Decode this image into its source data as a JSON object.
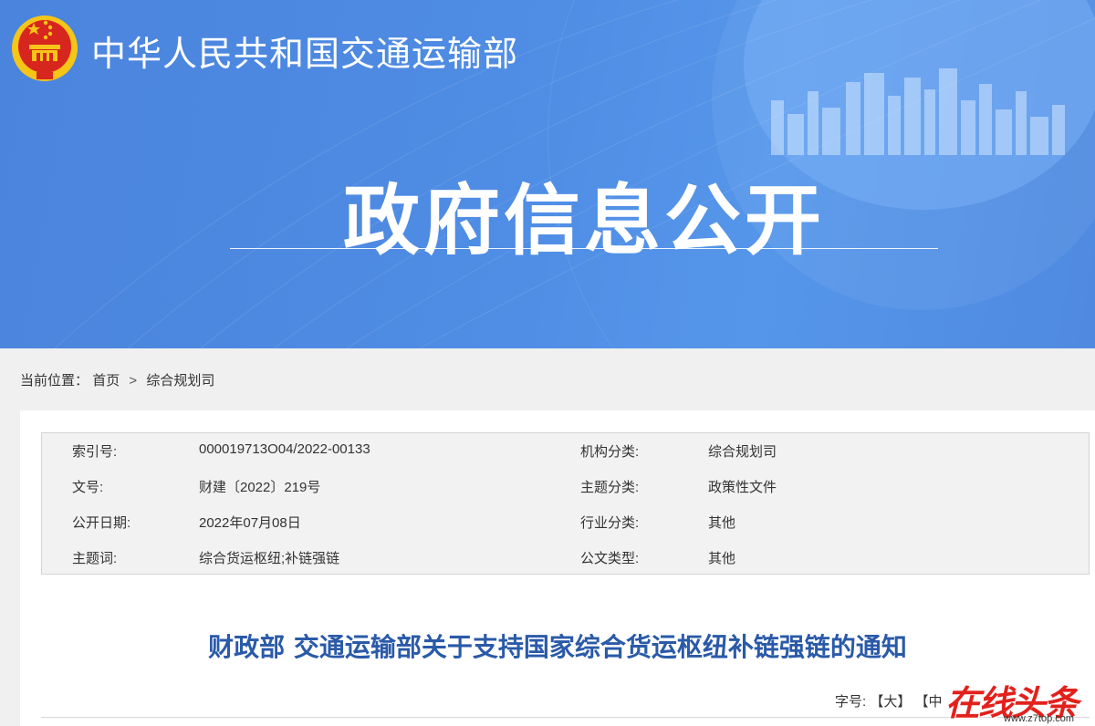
{
  "header": {
    "ministry_name": "中华人民共和国交通运输部",
    "banner_title": "政府信息公开"
  },
  "breadcrumb": {
    "label": "当前位置：",
    "items": [
      "首页",
      "综合规划司"
    ],
    "separator": ">"
  },
  "meta": {
    "rows": [
      {
        "key1": "索引号:",
        "val1": "000019713O04/2022-00133",
        "key2": "机构分类:",
        "val2": "综合规划司"
      },
      {
        "key1": "文号:",
        "val1": "财建〔2022〕219号",
        "key2": "主题分类:",
        "val2": "政策性文件"
      },
      {
        "key1": "公开日期:",
        "val1": "2022年07月08日",
        "key2": "行业分类:",
        "val2": "其他"
      },
      {
        "key1": "主题词:",
        "val1": "综合货运枢纽;补链强链",
        "key2": "公文类型:",
        "val2": "其他"
      }
    ]
  },
  "document": {
    "title": "财政部 交通运输部关于支持国家综合货运枢纽补链强链的通知"
  },
  "font_size": {
    "label": "字号:",
    "large": "【大】",
    "medium": "【中"
  },
  "watermark": {
    "text": "在线头条",
    "url": "www.z7top.com"
  },
  "colors": {
    "banner_blue": "#4f8ce4",
    "title_blue": "#2a5aa8",
    "emblem_red": "#d7261e",
    "emblem_gold": "#f5c518"
  }
}
